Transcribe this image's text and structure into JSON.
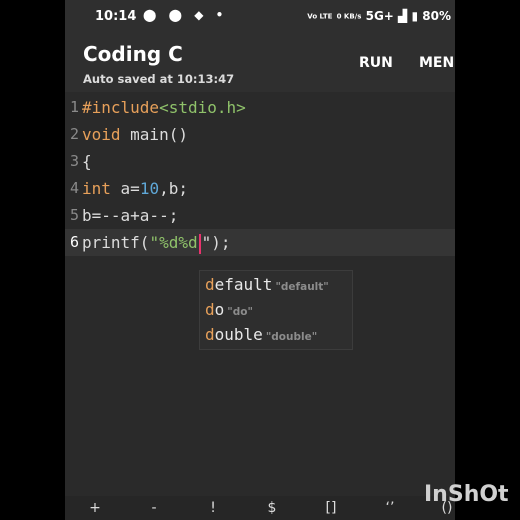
{
  "status_bar": {
    "time": "10:14",
    "notifications": "⬤ ⬤ ◆ •",
    "network_small": "Vo LTE",
    "speed": "0 KB/s",
    "signal": "5G+",
    "battery": "80%"
  },
  "app_bar": {
    "title": "Coding C",
    "subtitle": "Auto saved at 10:13:47",
    "run_label": "RUN",
    "menu_label": "MEN"
  },
  "editor": {
    "lines": [
      {
        "number": "1",
        "parts": [
          "#include",
          "<stdio.h>"
        ]
      },
      {
        "number": "2",
        "parts": [
          "void",
          " main()"
        ]
      },
      {
        "number": "3",
        "parts": [
          "{"
        ]
      },
      {
        "number": "4",
        "parts": [
          "int",
          " a=",
          "10",
          ",b;"
        ]
      },
      {
        "number": "5",
        "parts": [
          "b=--a+a--;"
        ]
      },
      {
        "number": "6",
        "parts": [
          "printf(",
          "\"%d%d",
          "\");"
        ]
      }
    ]
  },
  "autocomplete": {
    "items": [
      {
        "match": "d",
        "rest": "efault",
        "hint": "\"default\""
      },
      {
        "match": "d",
        "rest": "o",
        "hint": "\"do\""
      },
      {
        "match": "d",
        "rest": "ouble",
        "hint": "\"double\""
      }
    ]
  },
  "symbols": [
    "+",
    "-",
    "!",
    "$",
    "[]",
    "‘’",
    "()"
  ],
  "watermark": "InShOt"
}
